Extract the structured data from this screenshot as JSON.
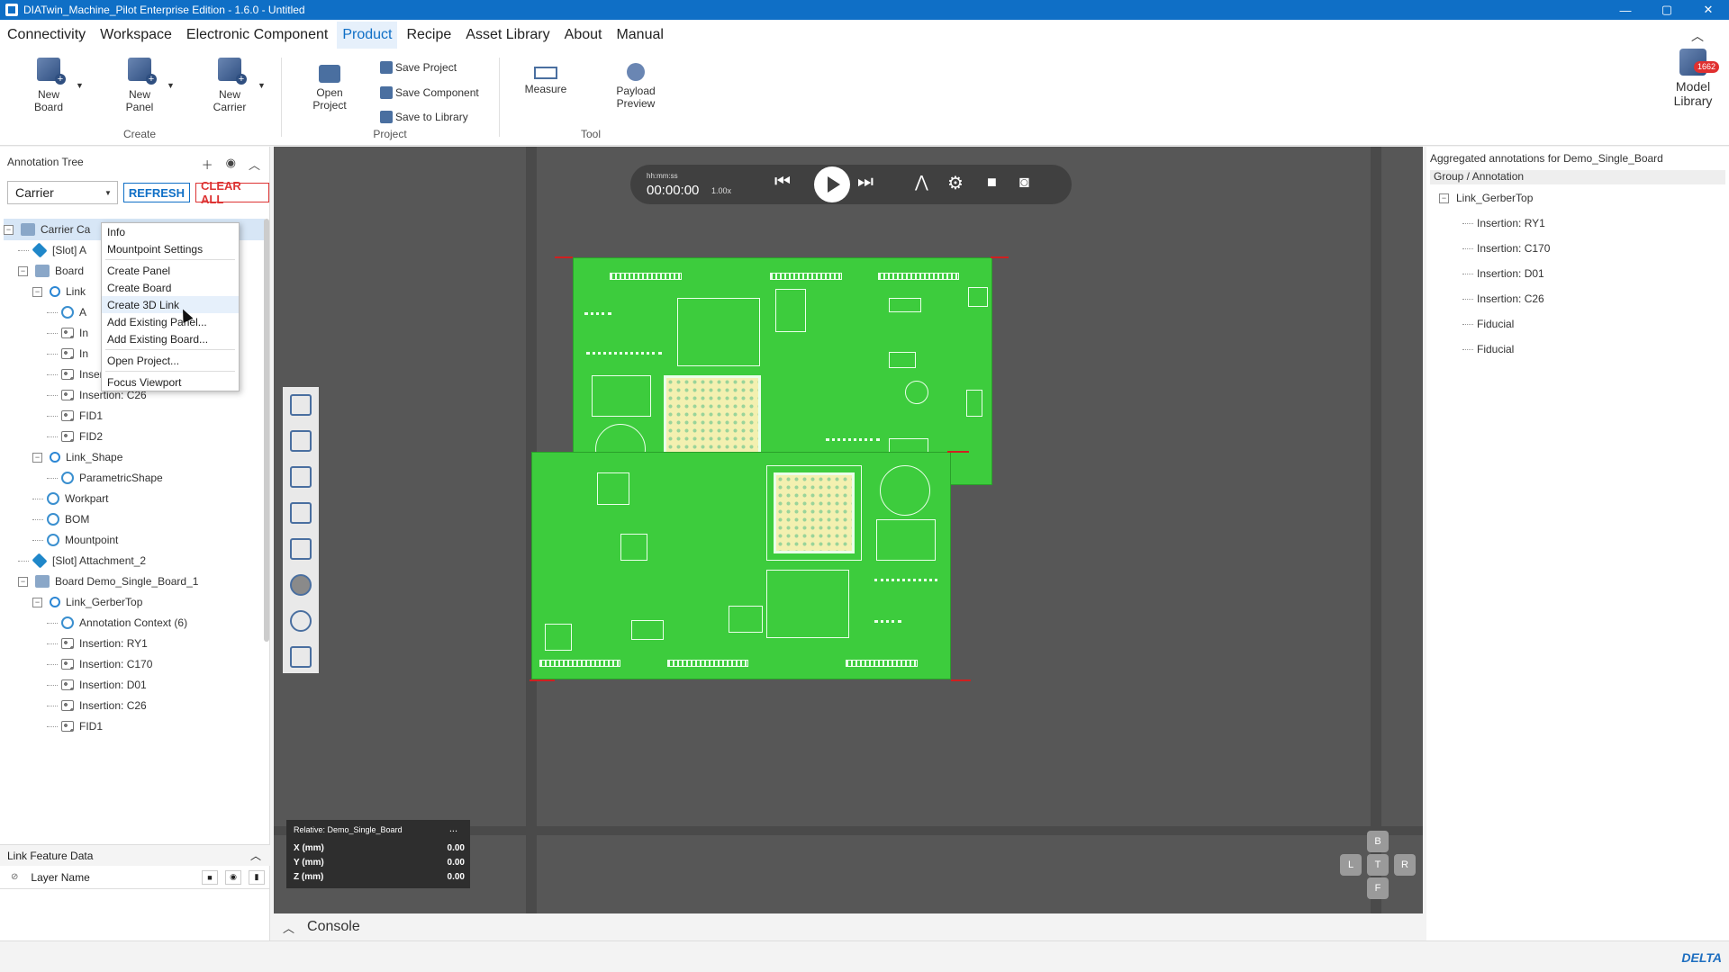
{
  "window": {
    "title": "DIATwin_Machine_Pilot Enterprise Edition - 1.6.0 - Untitled",
    "controls": [
      "—",
      "▢",
      "✕"
    ]
  },
  "menu": {
    "items": [
      "Connectivity",
      "Workspace",
      "Electronic Component",
      "Product",
      "Recipe",
      "Asset Library",
      "About",
      "Manual"
    ],
    "active": "Product"
  },
  "ribbon": {
    "create": {
      "label": "Create",
      "new_board": "New Board",
      "new_panel": "New Panel",
      "new_carrier": "New Carrier"
    },
    "project": {
      "label": "Project",
      "open_project": "Open Project",
      "save_project": "Save Project",
      "save_component": "Save Component",
      "save_to_library": "Save to Library"
    },
    "tool": {
      "label": "Tool",
      "measure": "Measure",
      "payload_preview": "Payload Preview"
    },
    "model_library": {
      "label": "Model Library",
      "badge": "1662"
    }
  },
  "annotation_tree": {
    "title": "Annotation Tree",
    "select_value": "Carrier",
    "refresh": "REFRESH",
    "clear_all": "CLEAR ALL",
    "rows": [
      {
        "text": "Carrier  Ca",
        "icon": "folder-icon",
        "level": 0,
        "toggle": "−"
      },
      {
        "text": "[Slot] A",
        "icon": "slot-icon",
        "level": 1,
        "toggle": ""
      },
      {
        "text": "Board",
        "icon": "folder-icon",
        "level": 1,
        "toggle": "−"
      },
      {
        "text": "Link",
        "icon": "link-icon",
        "level": 2,
        "toggle": "−"
      },
      {
        "text": "A",
        "icon": "context-icon",
        "level": 3,
        "toggle": ""
      },
      {
        "text": "In",
        "icon": "insertion-icon",
        "level": 3,
        "toggle": ""
      },
      {
        "text": "In",
        "icon": "insertion-icon",
        "level": 3,
        "toggle": ""
      },
      {
        "text": "Insertion: D01",
        "icon": "insertion-icon",
        "level": 3,
        "toggle": ""
      },
      {
        "text": "Insertion: C26",
        "icon": "insertion-icon",
        "level": 3,
        "toggle": ""
      },
      {
        "text": "FID1",
        "icon": "insertion-icon",
        "level": 3,
        "toggle": ""
      },
      {
        "text": "FID2",
        "icon": "insertion-icon",
        "level": 3,
        "toggle": ""
      },
      {
        "text": "Link_Shape",
        "icon": "link-icon",
        "level": 2,
        "toggle": "−"
      },
      {
        "text": "ParametricShape",
        "icon": "context-icon",
        "level": 3,
        "toggle": ""
      },
      {
        "text": "Workpart",
        "icon": "context-icon",
        "level": 2,
        "toggle": ""
      },
      {
        "text": "BOM",
        "icon": "context-icon",
        "level": 2,
        "toggle": ""
      },
      {
        "text": "Mountpoint",
        "icon": "context-icon",
        "level": 2,
        "toggle": ""
      },
      {
        "text": "[Slot] Attachment_2",
        "icon": "slot-icon",
        "level": 1,
        "toggle": ""
      },
      {
        "text": "Board  Demo_Single_Board_1",
        "icon": "folder-icon",
        "level": 1,
        "toggle": "−"
      },
      {
        "text": "Link_GerberTop",
        "icon": "link-icon",
        "level": 2,
        "toggle": "−"
      },
      {
        "text": "Annotation Context (6)",
        "icon": "context-icon",
        "level": 3,
        "toggle": ""
      },
      {
        "text": "Insertion: RY1",
        "icon": "insertion-icon",
        "level": 3,
        "toggle": ""
      },
      {
        "text": "Insertion: C170",
        "icon": "insertion-icon",
        "level": 3,
        "toggle": ""
      },
      {
        "text": "Insertion: D01",
        "icon": "insertion-icon",
        "level": 3,
        "toggle": ""
      },
      {
        "text": "Insertion: C26",
        "icon": "insertion-icon",
        "level": 3,
        "toggle": ""
      },
      {
        "text": "FID1",
        "icon": "insertion-icon",
        "level": 3,
        "toggle": ""
      }
    ]
  },
  "context_menu": {
    "items": [
      "Info",
      "Mountpoint Settings",
      "Create Panel",
      "Create Board",
      "Create 3D Link",
      "Add Existing Panel...",
      "Add Existing Board...",
      "Open Project...",
      "Focus Viewport"
    ],
    "highlighted": "Create 3D Link"
  },
  "link_feature": {
    "title": "Link Feature Data",
    "layer_name": "Layer Name"
  },
  "playback": {
    "label": "hh:mm:ss",
    "time": "00:00:00",
    "speed": "1.00x"
  },
  "coords": {
    "title": "Relative: Demo_Single_Board",
    "more": "...",
    "x_label": "X (mm)",
    "x": "0.00",
    "y_label": "Y (mm)",
    "y": "0.00",
    "z_label": "Z (mm)",
    "z": "0.00"
  },
  "navcube": {
    "top": "B",
    "left": "L",
    "center": "T",
    "right": "R",
    "bottom": "F"
  },
  "console": {
    "label": "Console"
  },
  "right_panel": {
    "title": "Aggregated annotations for Demo_Single_Board",
    "column": "Group / Annotation",
    "group": "Link_GerberTop",
    "items": [
      "Insertion: RY1",
      "Insertion: C170",
      "Insertion: D01",
      "Insertion: C26",
      "Fiducial",
      "Fiducial"
    ]
  },
  "status": {
    "brand": "DELTA"
  },
  "colors": {
    "accent": "#0f6fc6",
    "pcb": "#3dcc3d",
    "danger": "#d33333"
  }
}
